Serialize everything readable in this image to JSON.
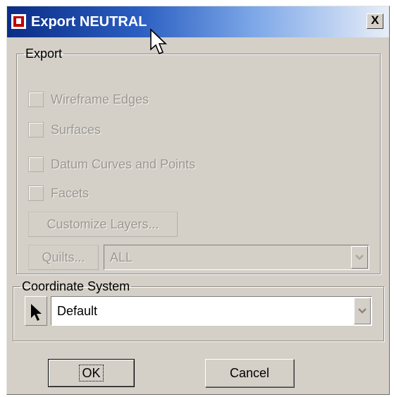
{
  "window": {
    "title": "Export NEUTRAL",
    "close_glyph": "X"
  },
  "export_group": {
    "label": "Export",
    "options": [
      {
        "label": "Wireframe Edges",
        "checked": false,
        "enabled": false
      },
      {
        "label": "Surfaces",
        "checked": false,
        "enabled": false
      },
      {
        "label": "Datum Curves and Points",
        "checked": false,
        "enabled": false
      },
      {
        "label": "Facets",
        "checked": false,
        "enabled": false
      }
    ],
    "customize_layers_label": "Customize Layers...",
    "quilts_label": "Quilts...",
    "quilts_value": "ALL"
  },
  "coord_group": {
    "label": "Coordinate System",
    "value": "Default",
    "select_icon": "arrow-pointer-icon"
  },
  "footer": {
    "ok_label": "OK",
    "cancel_label": "Cancel"
  },
  "colors": {
    "title_gradient_start": "#0b2d86",
    "title_gradient_end": "#e8eef8",
    "face": "#d4d0c8",
    "disabled_text": "#9b9891"
  }
}
